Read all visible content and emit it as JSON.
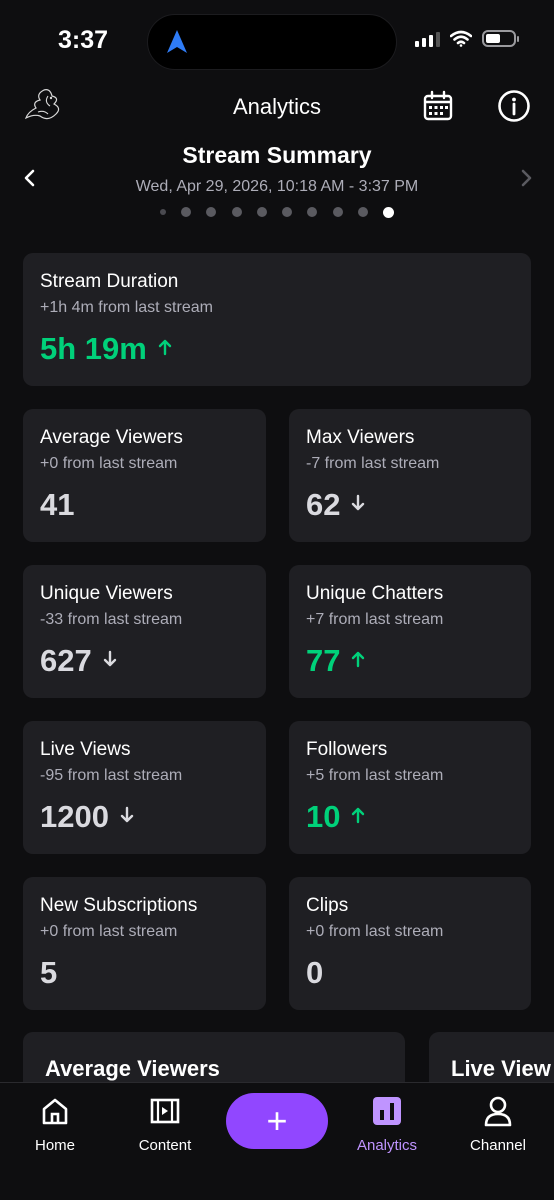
{
  "status_bar": {
    "time": "3:37",
    "battery_level": 0.55
  },
  "header": {
    "title": "Analytics"
  },
  "summary": {
    "title": "Stream Summary",
    "date": "Wed, Apr 29, 2026, 10:18 AM - 3:37 PM",
    "page_count": 10,
    "active_page": 10
  },
  "colors": {
    "accent": "#9147ff",
    "accent_light": "#bf94ff",
    "positive": "#00d17a",
    "card": "#1f1f23",
    "background": "#0e0e10"
  },
  "stats": {
    "stream_duration": {
      "label": "Stream Duration",
      "sub": "+1h 4m from last stream",
      "value": "5h 19m",
      "trend": "up"
    },
    "average_viewers": {
      "label": "Average Viewers",
      "sub": "+0 from last stream",
      "value": "41",
      "trend": "none"
    },
    "max_viewers": {
      "label": "Max Viewers",
      "sub": "-7 from last stream",
      "value": "62",
      "trend": "down"
    },
    "unique_viewers": {
      "label": "Unique Viewers",
      "sub": "-33 from last stream",
      "value": "627",
      "trend": "down"
    },
    "unique_chatters": {
      "label": "Unique Chatters",
      "sub": "+7 from last stream",
      "value": "77",
      "trend": "up"
    },
    "live_views": {
      "label": "Live Views",
      "sub": "-95 from last stream",
      "value": "1200",
      "trend": "down"
    },
    "followers": {
      "label": "Followers",
      "sub": "+5 from last stream",
      "value": "10",
      "trend": "up"
    },
    "new_subscriptions": {
      "label": "New Subscriptions",
      "sub": "+0 from last stream",
      "value": "5",
      "trend": "none"
    },
    "clips": {
      "label": "Clips",
      "sub": "+0 from last stream",
      "value": "0",
      "trend": "none"
    }
  },
  "charts": [
    {
      "title": "Average Viewers"
    },
    {
      "title": "Live View"
    }
  ],
  "nav": {
    "home": "Home",
    "content": "Content",
    "create": "+",
    "analytics": "Analytics",
    "channel": "Channel",
    "active": "analytics"
  },
  "icons": {
    "logo": "bird-logo-icon",
    "calendar": "calendar-icon",
    "info": "info-icon",
    "prev": "chevron-left-icon",
    "next": "chevron-right-icon",
    "home": "home-icon",
    "content": "film-icon",
    "analytics": "bar-chart-icon",
    "channel": "person-icon"
  }
}
